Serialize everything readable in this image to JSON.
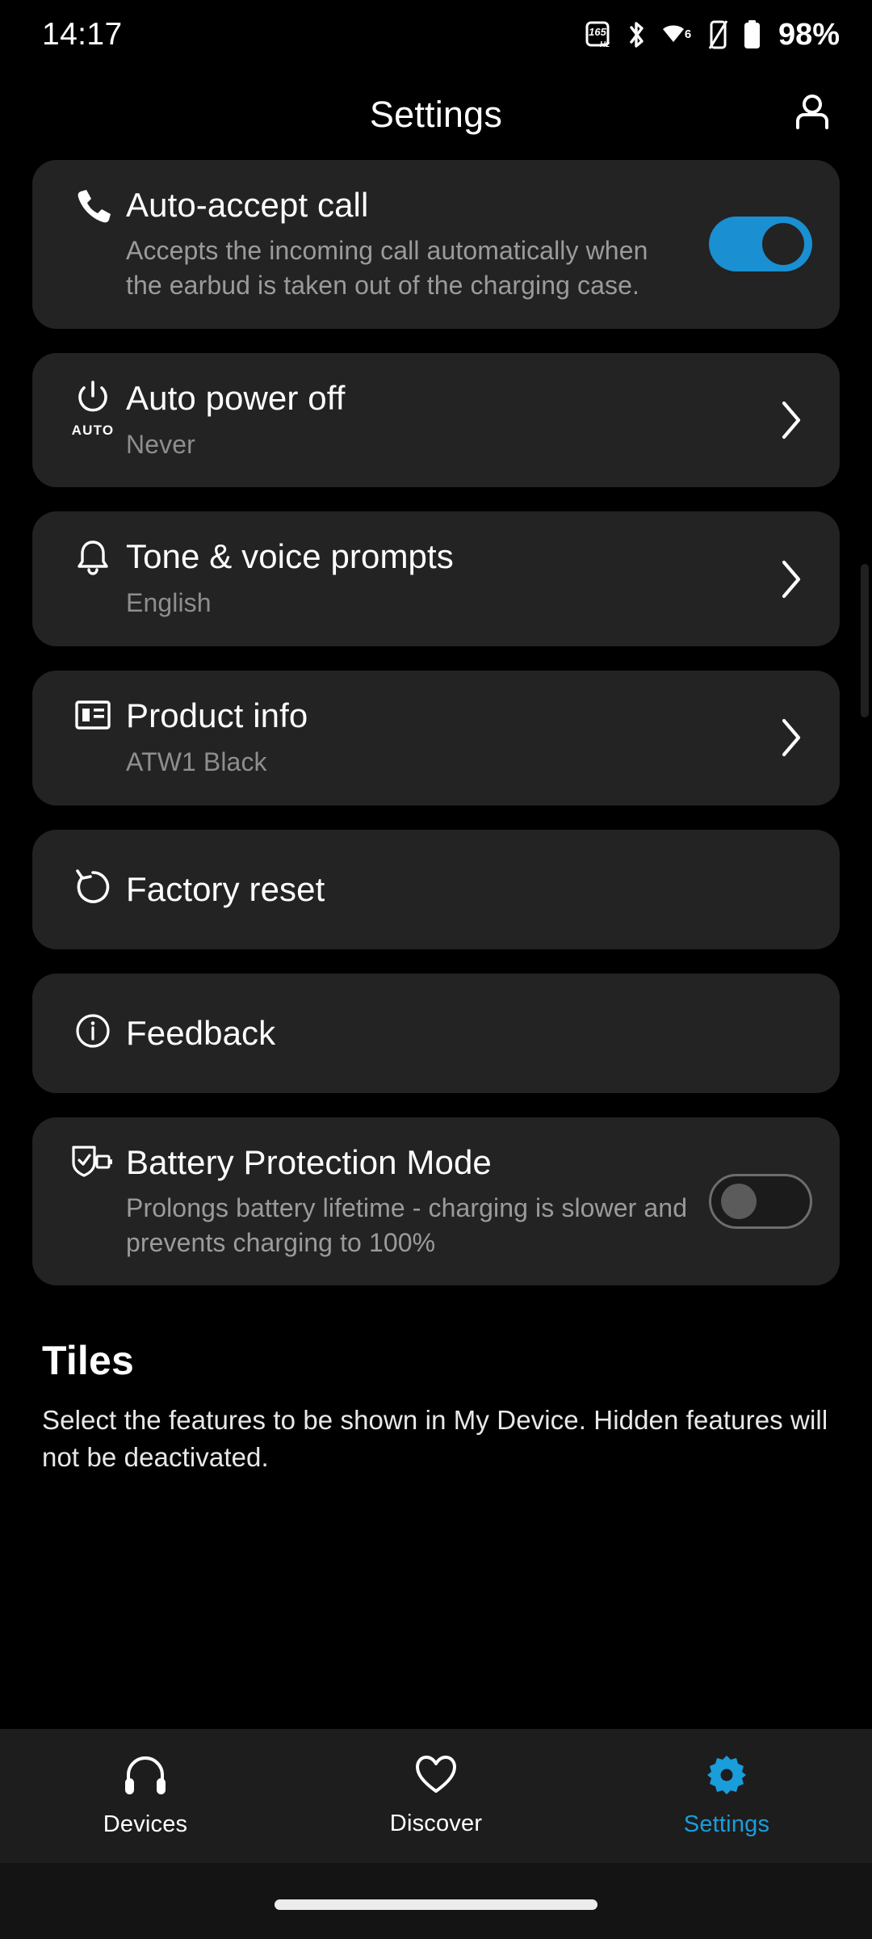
{
  "statusbar": {
    "time": "14:17",
    "battery_percent": "98%",
    "icons": [
      "refresh-rate-165hz-icon",
      "bluetooth-icon",
      "wifi-6-icon",
      "vibrate-icon",
      "battery-icon"
    ],
    "refresh_rate_value": "165",
    "refresh_rate_unit": "Hz",
    "wifi_generation": "6"
  },
  "header": {
    "title": "Settings",
    "account_icon": "person-icon"
  },
  "settings": [
    {
      "id": "auto-accept-call",
      "icon": "phone-icon",
      "title": "Auto-accept call",
      "subtitle": "Accepts the incoming call automatically when the earbud is taken out of the charging case.",
      "control": "toggle",
      "toggle_state": "on"
    },
    {
      "id": "auto-power-off",
      "icon": "power-auto-icon",
      "icon_label": "AUTO",
      "title": "Auto power off",
      "value": "Never",
      "control": "chevron"
    },
    {
      "id": "tone-voice-prompts",
      "icon": "bell-icon",
      "title": "Tone & voice prompts",
      "value": "English",
      "control": "chevron"
    },
    {
      "id": "product-info",
      "icon": "article-icon",
      "title": "Product info",
      "value": "ATW1 Black",
      "control": "chevron"
    },
    {
      "id": "factory-reset",
      "icon": "reset-icon",
      "title": "Factory reset",
      "control": "none"
    },
    {
      "id": "feedback",
      "icon": "info-circle-icon",
      "title": "Feedback",
      "control": "none"
    },
    {
      "id": "battery-protection-mode",
      "icon": "shield-battery-icon",
      "title": "Battery Protection Mode",
      "subtitle": "Prolongs battery lifetime - charging is slower and prevents charging to 100%",
      "control": "toggle",
      "toggle_state": "off"
    }
  ],
  "tiles": {
    "heading": "Tiles",
    "description": "Select the features to be shown in My Device. Hidden features will not be deactivated."
  },
  "bottom_nav": {
    "items": [
      {
        "id": "devices",
        "label": "Devices",
        "icon": "headphones-icon",
        "active": false
      },
      {
        "id": "discover",
        "label": "Discover",
        "icon": "heart-icon",
        "active": false
      },
      {
        "id": "settings",
        "label": "Settings",
        "icon": "gear-icon",
        "active": true
      }
    ]
  },
  "colors": {
    "background": "#000000",
    "card": "#232323",
    "accent": "#1a9ddb",
    "toggle_on": "#1a8fd1",
    "text_primary": "#ffffff",
    "text_secondary": "#9b9b9b"
  }
}
